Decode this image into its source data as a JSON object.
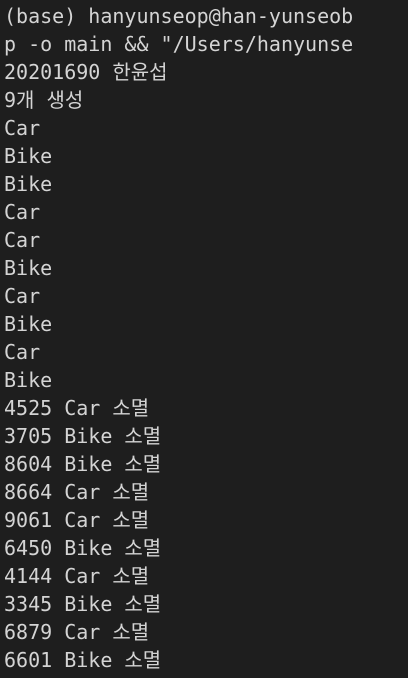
{
  "terminal": {
    "lines": [
      "(base) hanyunseop@han-yunseob",
      "p -o main && \"/Users/hanyunse",
      "20201690 한윤섭",
      "9개 생성",
      "Car",
      "Bike",
      "Bike",
      "Car",
      "Car",
      "Bike",
      "Car",
      "Bike",
      "Car",
      "Bike",
      "4525 Car 소멸",
      "3705 Bike 소멸",
      "8604 Bike 소멸",
      "8664 Car 소멸",
      "9061 Car 소멸",
      "6450 Bike 소멸",
      "4144 Car 소멸",
      "3345 Bike 소멸",
      "6879 Car 소멸",
      "6601 Bike 소멸"
    ]
  },
  "colors": {
    "background": "#1e1e1e",
    "text": "#d4d4d4"
  }
}
